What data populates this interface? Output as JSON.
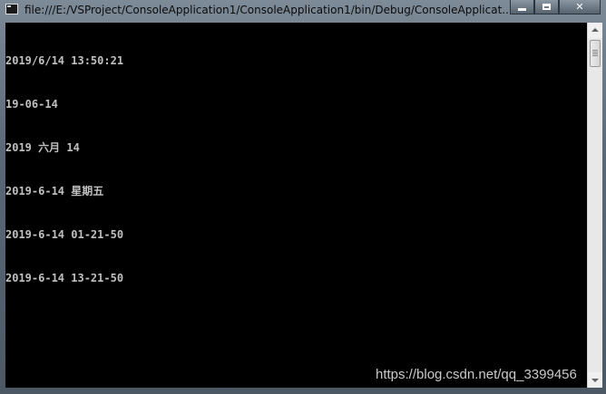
{
  "window": {
    "title": "file:///E:/VSProject/ConsoleApplication1/ConsoleApplication1/bin/Debug/ConsoleApplicat...",
    "caption_buttons": {
      "minimize_icon": "minimize-icon",
      "maximize_icon": "maximize-icon",
      "close_label": "✕"
    }
  },
  "console": {
    "lines": [
      "2019/6/14 13:50:21",
      "19-06-14",
      "2019 六月 14",
      "2019-6-14 星期五",
      "2019-6-14 01-21-50",
      "2019-6-14 13-21-50"
    ],
    "text_color": "#c0c0c0",
    "background": "#000000"
  },
  "watermark": {
    "text": "https://blog.csdn.net/qq_3399456"
  }
}
